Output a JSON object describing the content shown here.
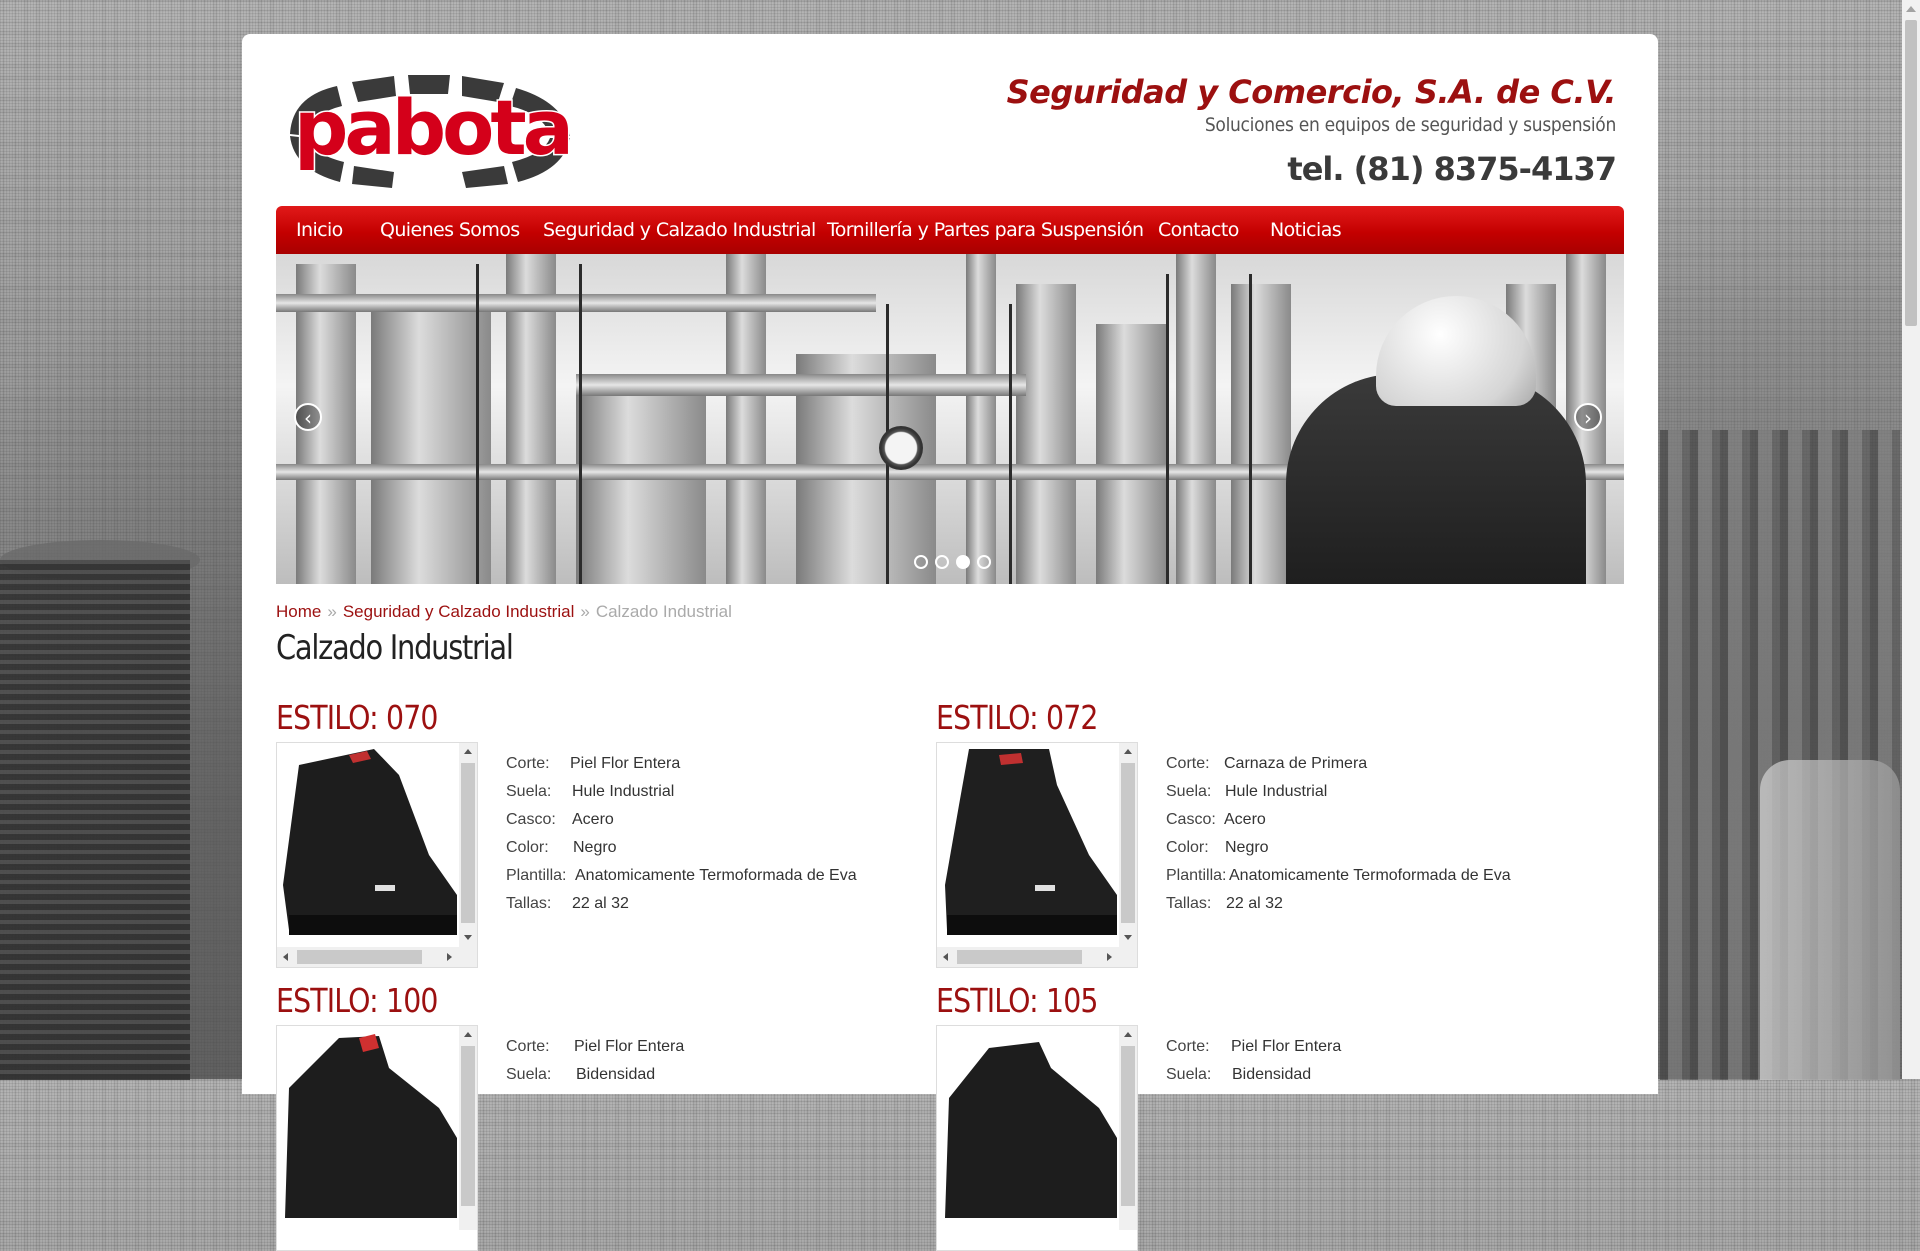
{
  "header": {
    "logo_text": "pabota",
    "company_name": "Seguridad y Comercio, S.A. de C.V.",
    "slogan": "Soluciones en equipos de seguridad y suspensión",
    "phone": "tel. (81) 8375-4137"
  },
  "nav": {
    "items": [
      {
        "label": "Inicio"
      },
      {
        "label": "Quienes Somos"
      },
      {
        "label": "Seguridad y Calzado Industrial"
      },
      {
        "label": "Tornillería y Partes para Suspensión"
      },
      {
        "label": "Contacto"
      },
      {
        "label": "Noticias"
      }
    ]
  },
  "slider": {
    "prev_icon": "chevron-left-icon",
    "next_icon": "chevron-right-icon",
    "slide_count": 4,
    "active_slide": 3
  },
  "breadcrumb": {
    "home": "Home",
    "sep": "»",
    "section": "Seguridad y Calzado Industrial",
    "current": "Calzado Industrial"
  },
  "page": {
    "title": "Calzado Industrial"
  },
  "products": [
    {
      "title": "ESTILO: 070",
      "specs": [
        {
          "label": "Corte:",
          "value": "Piel Flor Entera"
        },
        {
          "label": "Suela:",
          "value": "Hule Industrial"
        },
        {
          "label": "Casco:",
          "value": "Acero"
        },
        {
          "label": "Color:",
          "value": "Negro"
        },
        {
          "label": "Plantilla:",
          "value": "Anatomicamente Termoformada de Eva"
        },
        {
          "label": "Tallas:",
          "value": "22 al 32"
        }
      ]
    },
    {
      "title": "ESTILO: 072",
      "specs": [
        {
          "label": "Corte:",
          "value": "Carnaza de Primera"
        },
        {
          "label": "Suela:",
          "value": "Hule Industrial"
        },
        {
          "label": "Casco:",
          "value": "Acero"
        },
        {
          "label": "Color:",
          "value": "Negro"
        },
        {
          "label": "Plantilla:",
          "value": "Anatomicamente Termoformada de Eva"
        },
        {
          "label": "Tallas:",
          "value": "22 al 32"
        }
      ]
    },
    {
      "title": "ESTILO: 100",
      "specs": [
        {
          "label": "Corte:",
          "value": "Piel Flor Entera"
        },
        {
          "label": "Suela:",
          "value": "Bidensidad"
        }
      ]
    },
    {
      "title": "ESTILO: 105",
      "specs": [
        {
          "label": "Corte:",
          "value": "Piel Flor Entera"
        },
        {
          "label": "Suela:",
          "value": "Bidensidad"
        }
      ]
    }
  ],
  "colors": {
    "brand_red": "#9c1010",
    "nav_red": "#c40000",
    "text": "#333333"
  }
}
